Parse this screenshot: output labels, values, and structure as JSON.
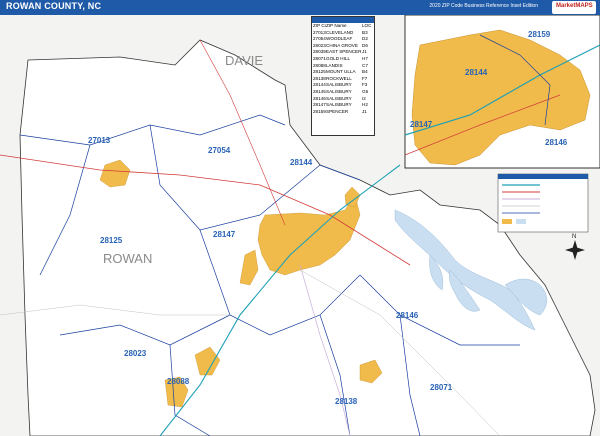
{
  "title": "ROWAN COUNTY, NC",
  "subtitle": "2020 ZIP Code Business Reference Inset Edition",
  "logo_text": "MarketMAPS",
  "colors": {
    "title_bar": "#1f5aa8",
    "water": "#c9def0",
    "urban": "#f0bb4a",
    "zip_label": "#2a63b5",
    "boundary": "#1a3fa0",
    "road_red": "#d33b3b",
    "road_teal": "#1fa0b5"
  },
  "map": {
    "neighbor_labels": [
      "DAVIE"
    ],
    "county_label": "ROWAN",
    "zip_labels": [
      "27013",
      "27054",
      "28144",
      "28125",
      "28147",
      "28146",
      "28023",
      "28088",
      "28138",
      "28071"
    ],
    "inset_zip_labels": [
      "28159",
      "28144",
      "28147",
      "28146"
    ]
  },
  "zip_table": {
    "headers": [
      "ZIP Code",
      "ZIP Name",
      "LOC"
    ],
    "rows": [
      [
        "27013",
        "CLEVELAND",
        "B3"
      ],
      [
        "27054",
        "WOODLEAF",
        "D2"
      ],
      [
        "28023",
        "CHINA GROVE",
        "D6"
      ],
      [
        "28039",
        "EAST SPENCER",
        "J1"
      ],
      [
        "28071",
        "GOLD HILL",
        "H7"
      ],
      [
        "28088",
        "LANDIS",
        "C7"
      ],
      [
        "28125",
        "MOUNT ULLA",
        "B4"
      ],
      [
        "28138",
        "ROCKWELL",
        "F7"
      ],
      [
        "28144",
        "SALISBURY",
        "F3"
      ],
      [
        "28145",
        "SALISBURY",
        "G5"
      ],
      [
        "28146",
        "SALISBURY",
        "I2"
      ],
      [
        "28147",
        "SALISBURY",
        "H2"
      ],
      [
        "28159",
        "SPENCER",
        "J1"
      ]
    ]
  },
  "legend_title": "",
  "compass_label": "N"
}
